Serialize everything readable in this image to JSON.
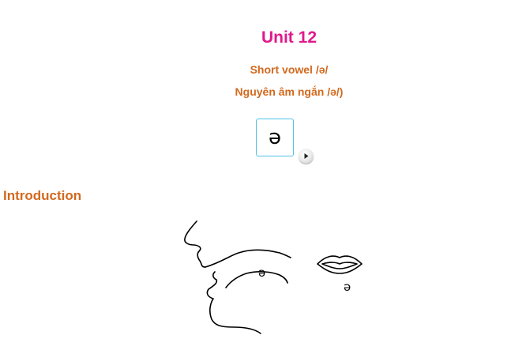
{
  "lesson": {
    "title": "Unit 12",
    "subtitle_en": "Short vowel /ə/",
    "subtitle_vi": "Nguyên âm ngắn /ə/)",
    "symbol": "ə",
    "play_icon": "play-icon"
  },
  "introduction": {
    "heading": "Introduction",
    "mouth_label": "ə",
    "lips_label": "ə"
  },
  "colors": {
    "title": "#e0198c",
    "subtitle": "#d2691e",
    "heading": "#d2691e",
    "symbol_border": "#4fc3e8"
  }
}
